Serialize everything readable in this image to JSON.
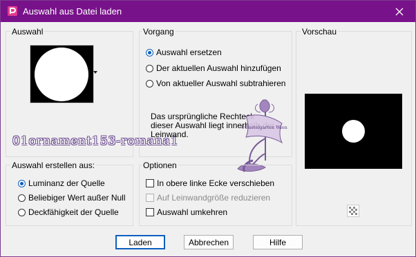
{
  "window": {
    "title": "Auswahl aus Datei laden",
    "close_icon": "close-icon",
    "app_icon": "paintshop-app-icon",
    "accent": "#78128a"
  },
  "groups": {
    "auswahl": {
      "legend": "Auswahl"
    },
    "vorgang": {
      "legend": "Vorgang"
    },
    "vorschau": {
      "legend": "Vorschau"
    },
    "erstellen": {
      "legend": "Auswahl erstellen aus:"
    },
    "optionen": {
      "legend": "Optionen"
    }
  },
  "vorgang": {
    "options": [
      {
        "label": "Auswahl ersetzen",
        "selected": true
      },
      {
        "label": "Der aktuellen Auswahl hinzufügen",
        "selected": false
      },
      {
        "label": "Von aktueller Auswahl subtrahieren",
        "selected": false
      }
    ],
    "info": "Das ursprüngliche Rechteck dieser Auswahl liegt innerhalb der Leinwand."
  },
  "erstellen": {
    "options": [
      {
        "label": "Luminanz der Quelle",
        "selected": true
      },
      {
        "label": "Beliebiger Wert außer Null",
        "selected": false
      },
      {
        "label": "Deckfähigkeit der Quelle",
        "selected": false
      }
    ]
  },
  "optionen": {
    "items": [
      {
        "label": "In obere linke Ecke verschieben",
        "checked": false,
        "enabled": true
      },
      {
        "label": "Auf Leinwandgröße reduzieren",
        "checked": false,
        "enabled": false
      },
      {
        "label": "Auswahl umkehren",
        "checked": false,
        "enabled": true
      }
    ]
  },
  "selection_name": "01ornament153-romana1",
  "watermark": {
    "text": "©Bastelgarten Wien"
  },
  "buttons": {
    "laden": "Laden",
    "abbrechen": "Abbrechen",
    "hilfe": "Hilfe"
  }
}
